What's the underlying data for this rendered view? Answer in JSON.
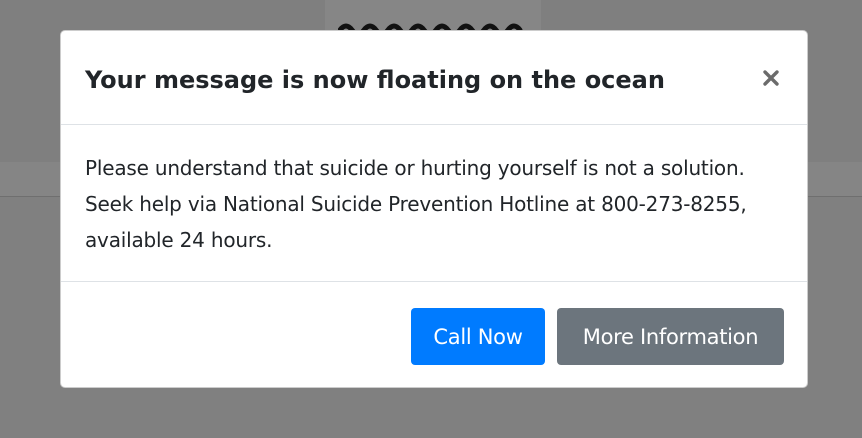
{
  "modal": {
    "title": "Your message is now floating on the ocean",
    "close_icon": "close-icon",
    "body_text": "Please understand that suicide or hurting yourself is not a solution. Seek help via National Suicide Prevention Hotline at 800-273-8255, available 24 hours.",
    "buttons": {
      "call_now_label": "Call Now",
      "more_info_label": "More Information"
    }
  },
  "colors": {
    "primary": "#007bff",
    "secondary": "#6c757d",
    "backdrop": "#808080",
    "text": "#212529"
  }
}
